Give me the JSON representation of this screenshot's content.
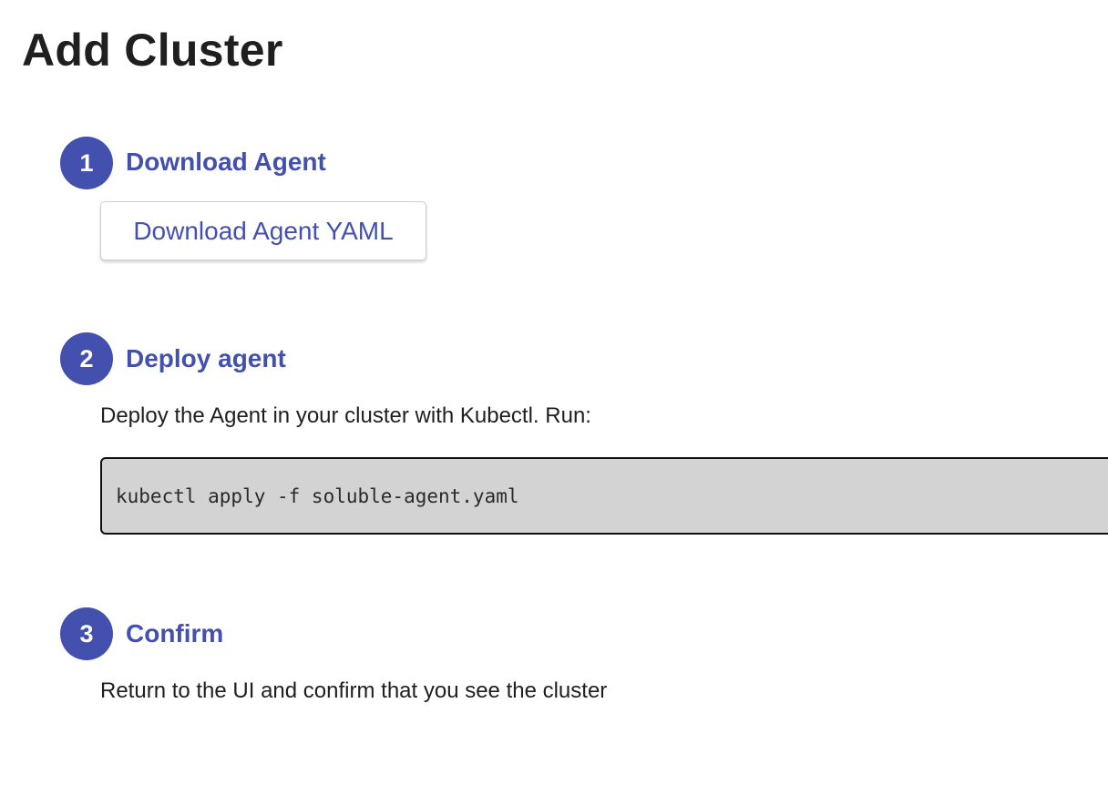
{
  "page": {
    "title": "Add Cluster"
  },
  "theme": {
    "accent": "#4350ae"
  },
  "steps": [
    {
      "number": "1",
      "title": "Download Agent",
      "button_label": "Download Agent YAML"
    },
    {
      "number": "2",
      "title": "Deploy agent",
      "description": "Deploy the Agent in your cluster with Kubectl. Run:",
      "command": "kubectl apply -f soluble-agent.yaml"
    },
    {
      "number": "3",
      "title": "Confirm",
      "description": "Return to the UI and confirm that you see the cluster"
    }
  ]
}
